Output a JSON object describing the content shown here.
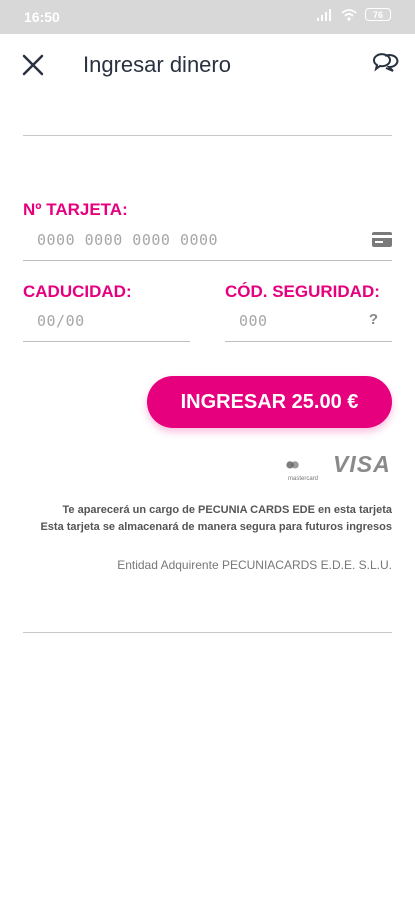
{
  "status": {
    "time": "16:50",
    "battery": "76"
  },
  "header": {
    "title": "Ingresar dinero"
  },
  "form": {
    "card_label": "Nº TARJETA:",
    "card_placeholder": "0000 0000 0000 0000",
    "expiry_label": "CADUCIDAD:",
    "expiry_placeholder": "00/00",
    "cvv_label": "CÓD. SEGURIDAD:",
    "cvv_placeholder": "000",
    "cvv_help": "?"
  },
  "submit": {
    "label": "INGRESAR 25.00 €"
  },
  "brands": {
    "mastercard_text": "mastercard",
    "visa_text": "VISA"
  },
  "info": {
    "line1": "Te aparecerá un cargo de PECUNIA CARDS EDE en esta tarjeta",
    "line2": "Esta tarjeta se almacenará de manera segura para futuros ingresos",
    "acquirer": "Entidad Adquirente PECUNIACARDS E.D.E. S.L.U."
  },
  "colors": {
    "accent": "#e6007e",
    "title": "#2a3140"
  }
}
